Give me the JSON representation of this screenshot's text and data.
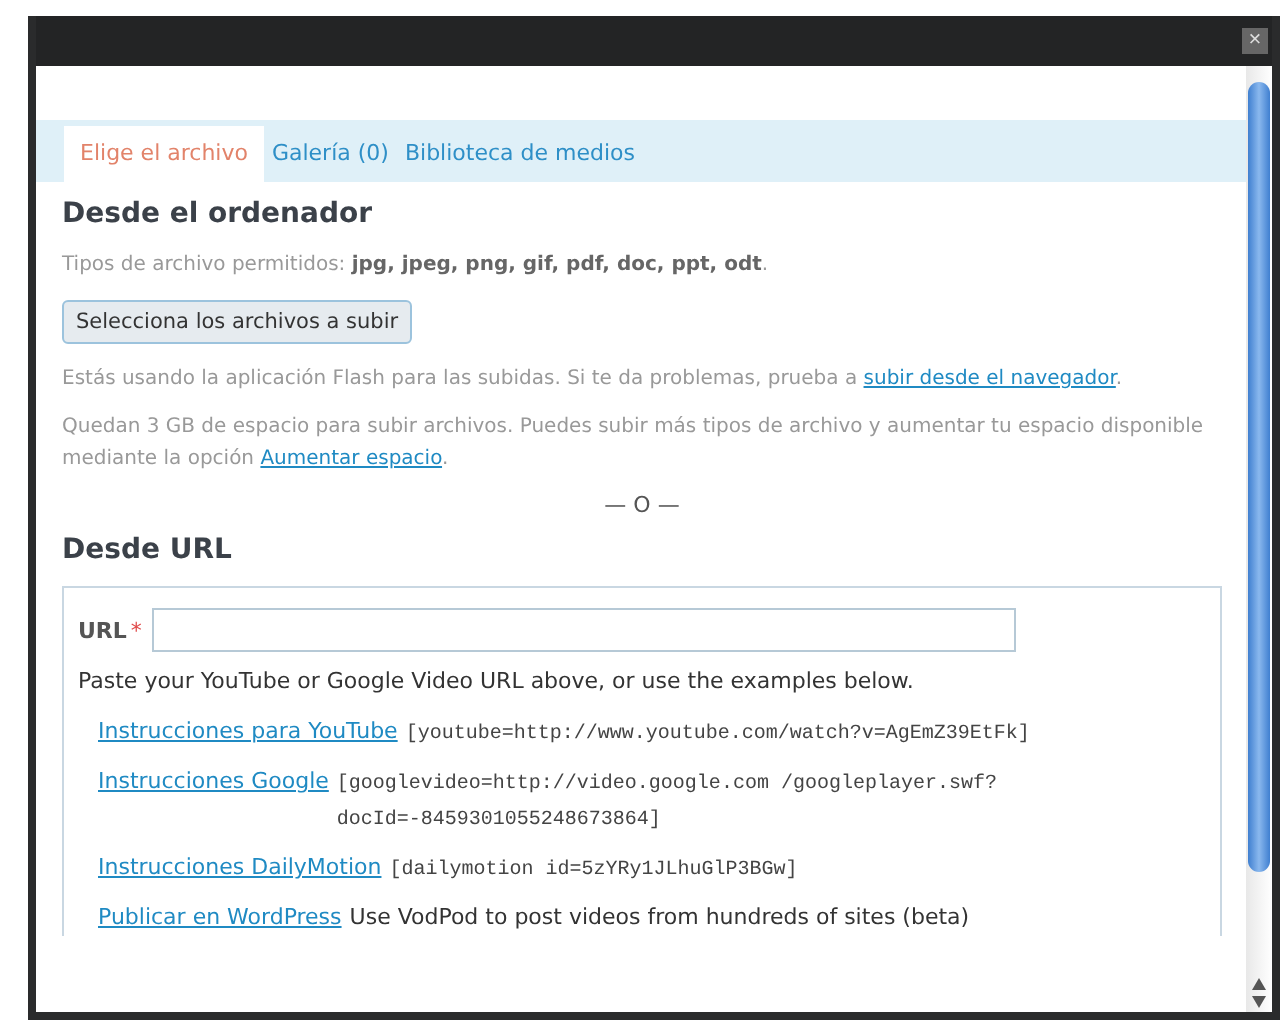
{
  "window": {
    "close_label": "×"
  },
  "tabs": [
    {
      "label": "Elige el archivo",
      "selected": true
    },
    {
      "label": "Galería (0)",
      "selected": false
    },
    {
      "label": "Biblioteca de medios",
      "selected": false
    }
  ],
  "computer": {
    "heading": "Desde el ordenador",
    "types": "Tipos de archivo permitidos: **jpg, jpeg, png, gif, pdf, doc, ppt, odt**.",
    "button": "Selecciona los archivos a subir",
    "paragraphs": [
      [
        {
          "kind": "text",
          "text": "Estás usando la aplicación Flash para las subidas. Si te da problemas, prueba a "
        },
        {
          "kind": "link",
          "text": "subir desde el navegador"
        },
        {
          "kind": "text",
          "text": "."
        }
      ],
      [
        {
          "kind": "text",
          "text": "Quedan 3 GB de espacio para subir archivos. Puedes subir más tipos de archivo y aumentar tu espacio disponible mediante la opción "
        },
        {
          "kind": "link",
          "text": "Aumentar espacio"
        },
        {
          "kind": "text",
          "text": "."
        }
      ]
    ],
    "separator": "— O —"
  },
  "url": {
    "heading": "Desde URL",
    "label": "URL",
    "required_mark": "*",
    "hint": "Paste your YouTube or Google Video URL above, or use the examples below.",
    "examples": [
      {
        "link": "Instrucciones para YouTube",
        "note": "[youtube=http://www.youtube.com/watch?v=AgEmZ39EtFk]",
        "kind": "code"
      },
      {
        "link": "Instrucciones Google",
        "note": "[googlevideo=http://video.google.com /googleplayer.swf?docId=-8459301055248673864]",
        "kind": "code"
      },
      {
        "link": "Instrucciones DailyMotion",
        "note": "[dailymotion id=5zYRy1JLhuGlP3BGw]",
        "kind": "code"
      },
      {
        "link": "Publicar en WordPress",
        "note": "Use VodPod to post videos from hundreds of sites (beta)",
        "kind": "plain"
      }
    ]
  }
}
